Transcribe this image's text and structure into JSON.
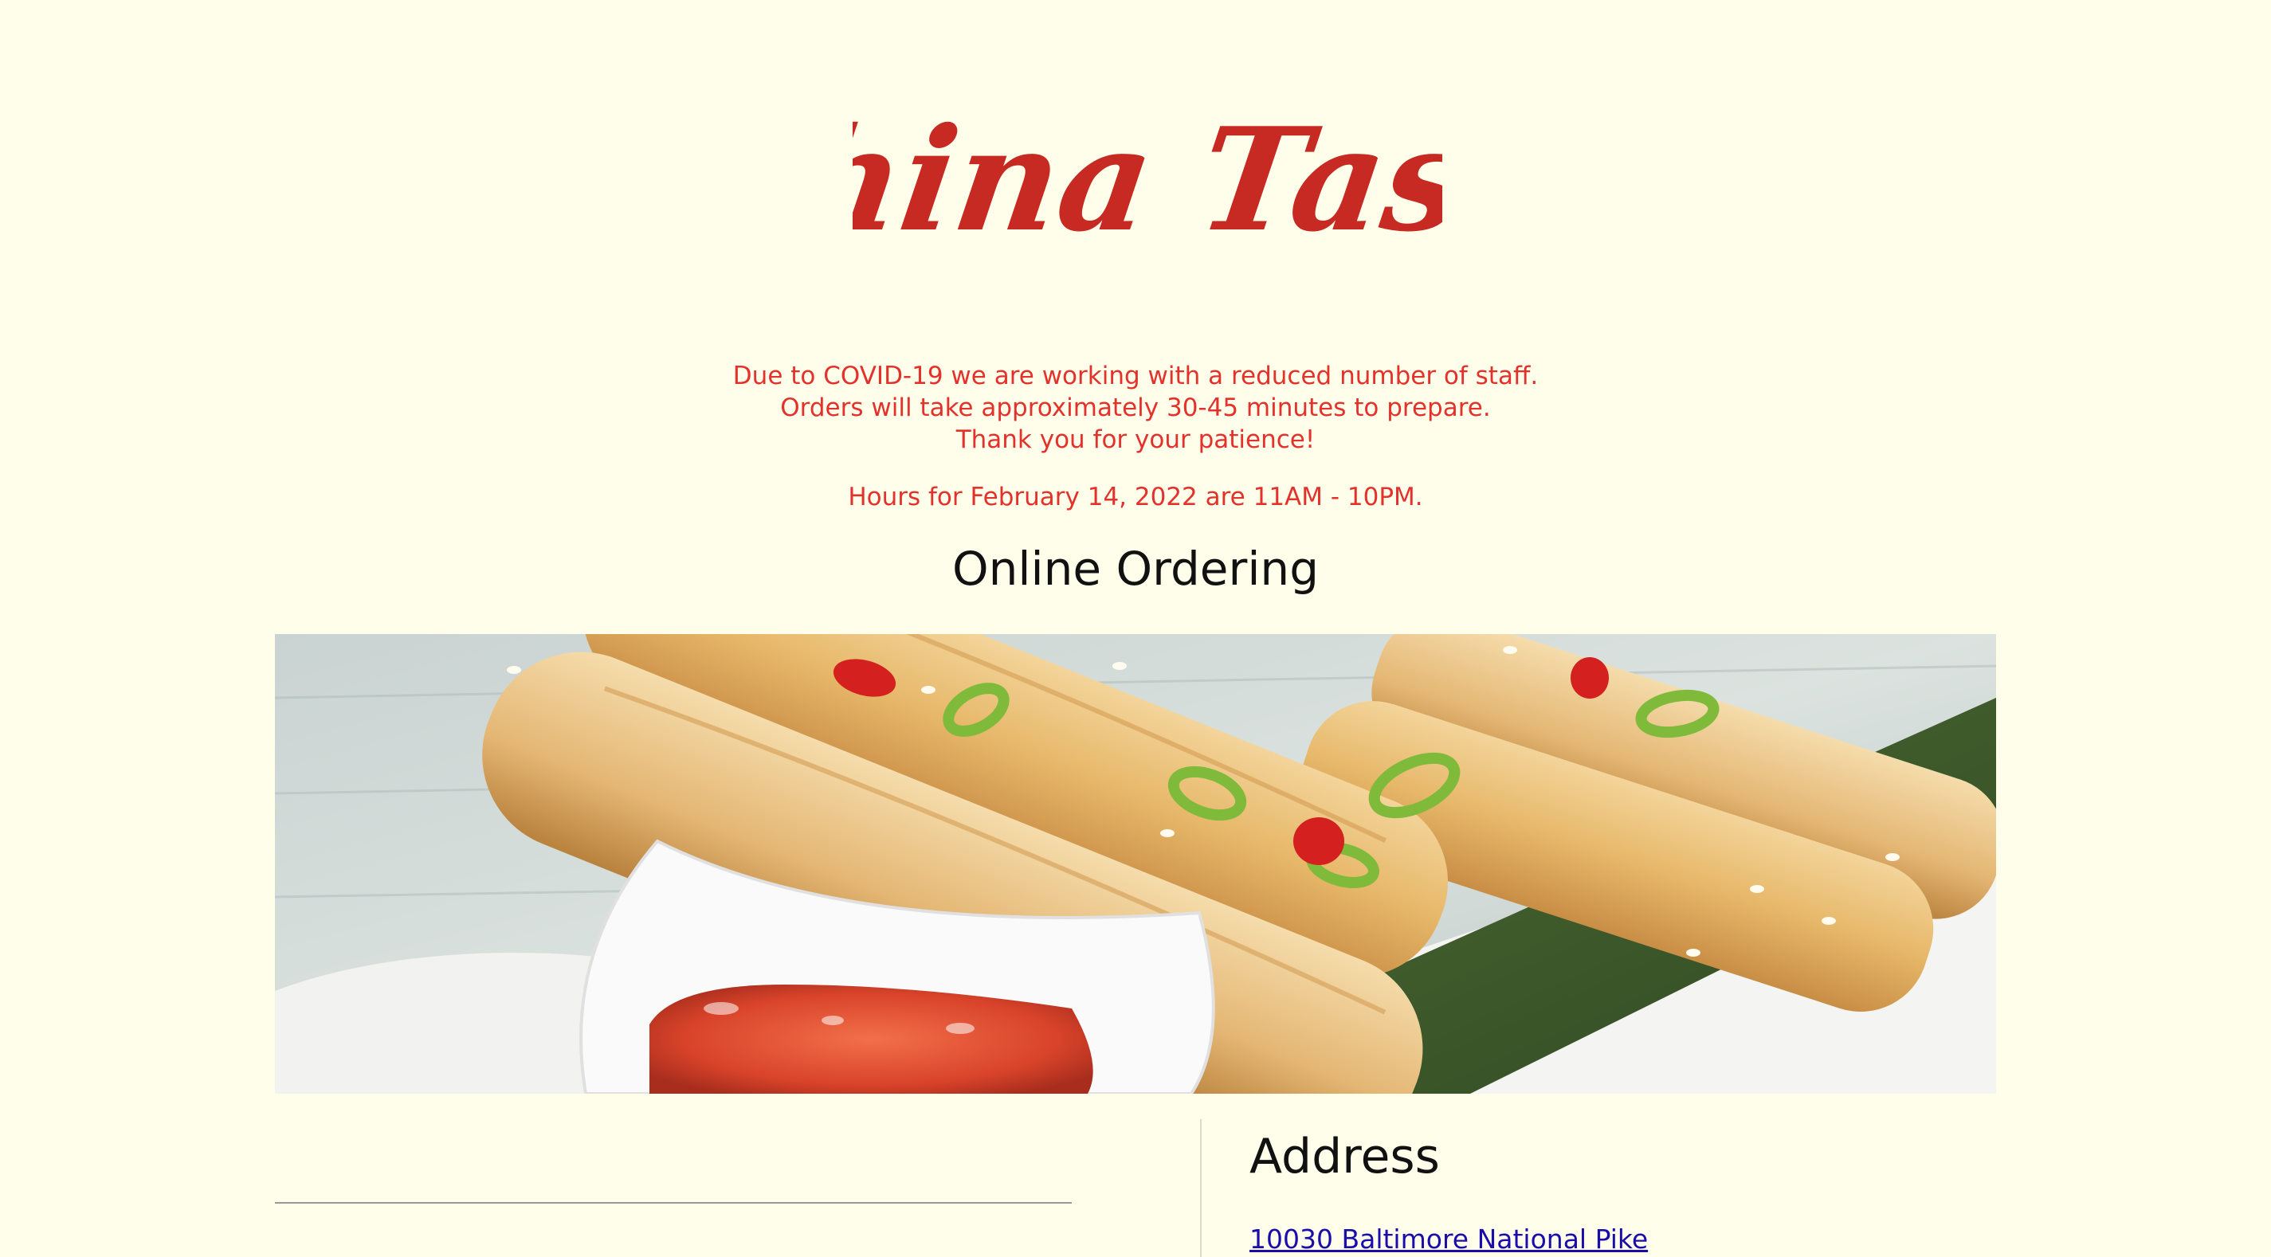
{
  "brand": {
    "logo_text": "China Taste",
    "logo_color": "#c62a22"
  },
  "notice": {
    "covid_lines": [
      "Due to COVID-19 we are working with a reduced number of staff.",
      "Orders will take approximately 30-45 minutes to prepare.",
      "Thank you for your patience!"
    ],
    "hours": "Hours for February 14, 2022 are 11AM - 10PM.",
    "color": "#e3322b"
  },
  "main": {
    "title": "Online Ordering",
    "hero_image": "spring-rolls-with-dipping-sauce-photo"
  },
  "address": {
    "heading": "Address",
    "street": "10030 Baltimore National Pike"
  },
  "colors": {
    "background": "#fffeeb",
    "link": "#1a0dab"
  }
}
